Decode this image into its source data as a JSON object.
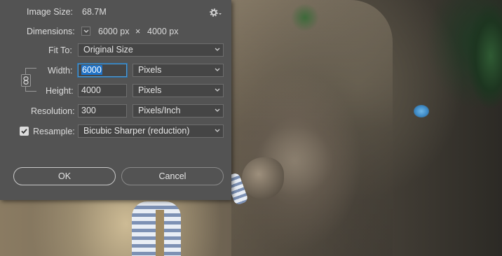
{
  "dialog": {
    "image_size": {
      "label": "Image Size:",
      "value": "68.7M"
    },
    "dimensions": {
      "label": "Dimensions:",
      "width": "6000 px",
      "separator": "×",
      "height": "4000 px"
    },
    "fit_to": {
      "label": "Fit To:",
      "value": "Original Size"
    },
    "width": {
      "label": "Width:",
      "value": "6000",
      "unit": "Pixels"
    },
    "height": {
      "label": "Height:",
      "value": "4000",
      "unit": "Pixels"
    },
    "resolution": {
      "label": "Resolution:",
      "value": "300",
      "unit": "Pixels/Inch"
    },
    "resample": {
      "label": "Resample:",
      "checked": true,
      "value": "Bicubic Sharper (reduction)"
    },
    "buttons": {
      "ok": "OK",
      "cancel": "Cancel"
    },
    "icons": {
      "settings": "gear-icon",
      "constrain": "chain-link-icon",
      "dimensions_toggle": "chevron-down-icon"
    }
  },
  "colors": {
    "dialog_bg": "#535353",
    "field_bg": "#454545",
    "focus": "#4e9bd6",
    "selection": "#1f73c9"
  }
}
